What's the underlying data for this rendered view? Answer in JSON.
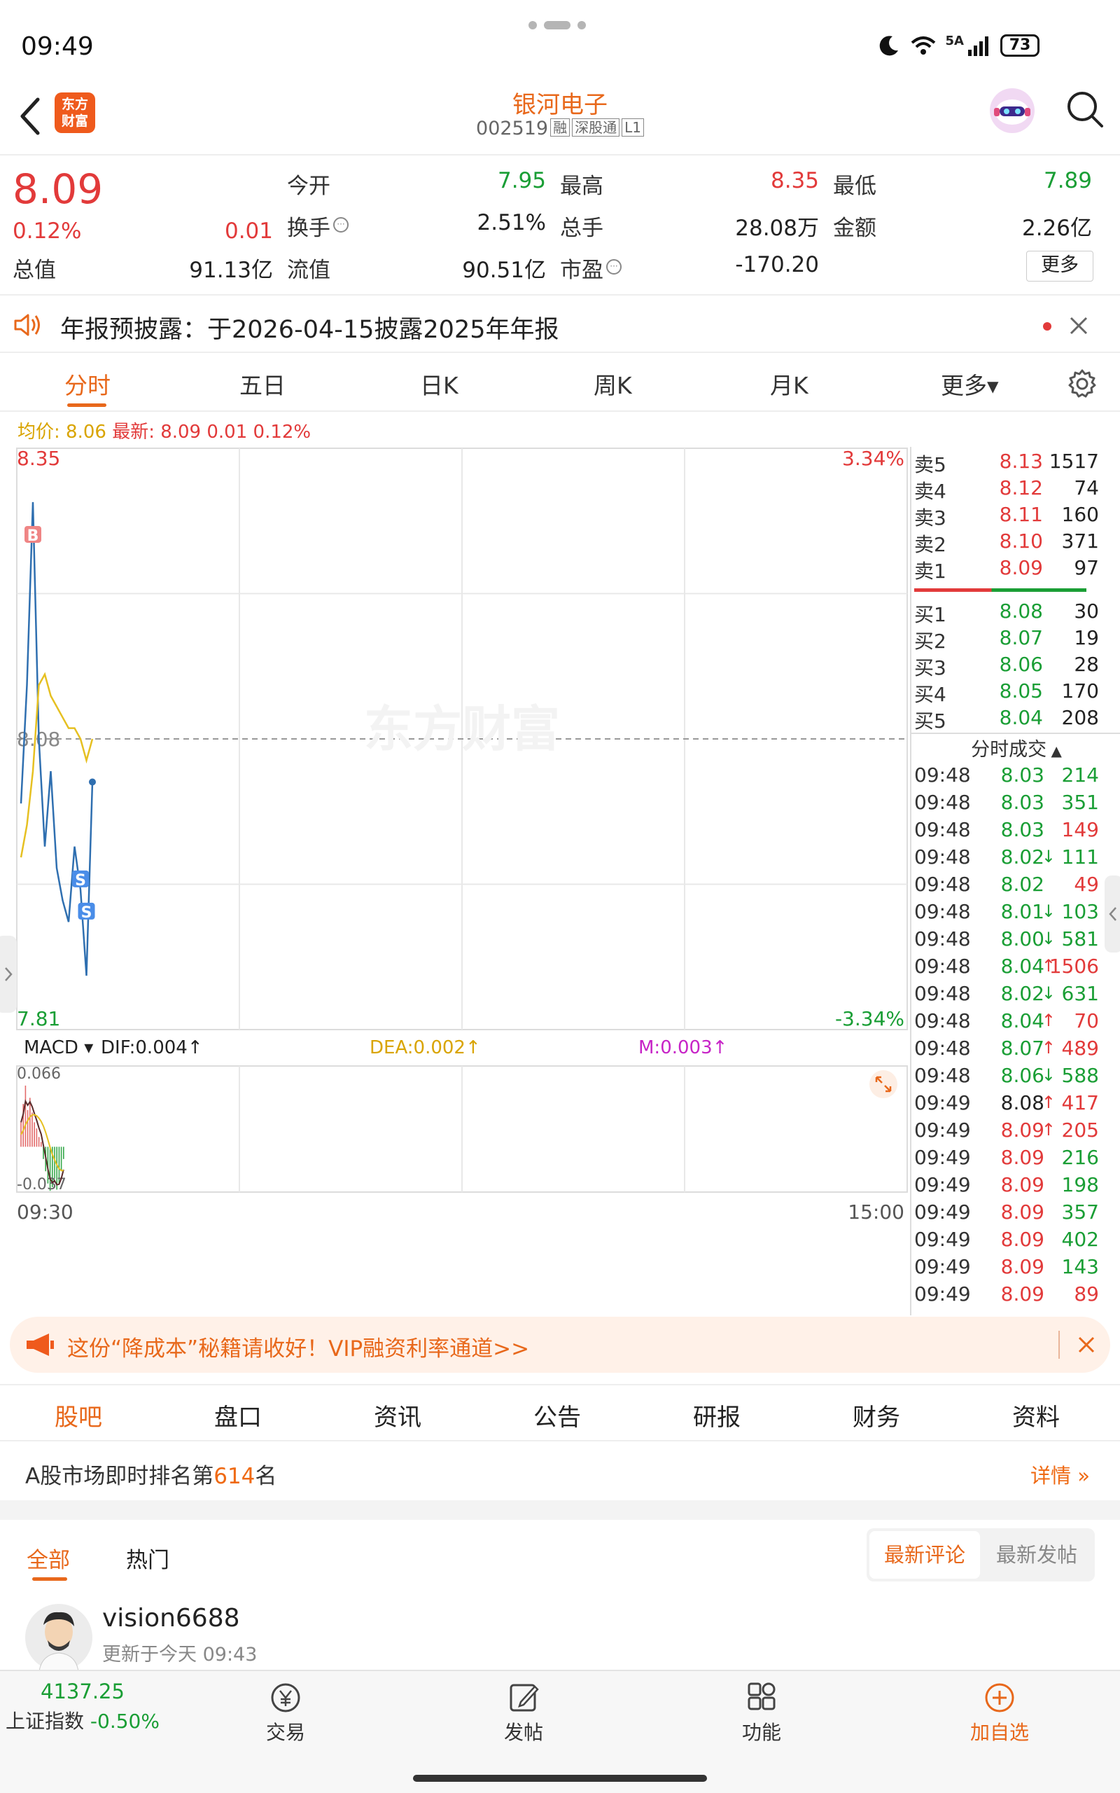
{
  "status_bar": {
    "time": "09:49",
    "network": "5A",
    "battery": "73"
  },
  "header": {
    "app_logo": "东方财富",
    "stock_name": "银河电子",
    "stock_code": "002519",
    "tags": [
      "融",
      "深股通",
      "L1"
    ]
  },
  "quote": {
    "price": "8.09",
    "change_pct": "0.12%",
    "change": "0.01",
    "total_value_label": "总值",
    "total_value": "91.13亿",
    "fields": [
      {
        "label": "今开",
        "value": "7.95",
        "color": "#1a9e35"
      },
      {
        "label": "最高",
        "value": "8.35",
        "color": "#e23a3a"
      },
      {
        "label": "最低",
        "value": "7.89",
        "color": "#1a9e35"
      },
      {
        "label": "换手",
        "value": "2.51%",
        "color": "#222222"
      },
      {
        "label": "总手",
        "value": "28.08万",
        "color": "#222222"
      },
      {
        "label": "金额",
        "value": "2.26亿",
        "color": "#222222"
      },
      {
        "label": "流值",
        "value": "90.51亿",
        "color": "#222222"
      },
      {
        "label": "市盈",
        "value": "-170.20",
        "color": "#222222"
      }
    ],
    "more_button": "更多"
  },
  "notice": {
    "text": "年报预披露：于2026-04-15披露2025年年报"
  },
  "chart_tabs": [
    "分时",
    "五日",
    "日K",
    "周K",
    "月K",
    "更多▾"
  ],
  "chart_legend": {
    "avg_label": "均价: 8.06",
    "latest_label": "最新: 8.09 0.01 0.12%"
  },
  "chart_data": [
    {
      "type": "line",
      "title": "",
      "ylim": [
        7.81,
        8.35
      ],
      "y_max_label": "8.35",
      "y_min_label": "7.81",
      "ref_label": "8.08",
      "pct_max_label": "3.34%",
      "pct_min_label": "-3.34%",
      "x_start_label": "09:30",
      "x_end_label": "15:00",
      "watermark": "东方财富",
      "series": [
        {
          "values": [
            8.02,
            8.13,
            8.3,
            8.08,
            7.98,
            8.05,
            7.96,
            7.93,
            7.91,
            7.98,
            7.94,
            7.86,
            8.04
          ]
        },
        {
          "values": [
            7.97,
            8.0,
            8.05,
            8.13,
            8.14,
            8.12,
            8.11,
            8.1,
            8.09,
            8.09,
            8.08,
            8.06,
            8.08
          ]
        }
      ],
      "markers": [
        {
          "label": "B",
          "value": 8.27
        },
        {
          "label": "S",
          "value": 7.95
        },
        {
          "label": "S",
          "value": 7.92
        }
      ]
    },
    {
      "type": "bar",
      "title": "",
      "indicator": "MACD",
      "dif_label": "DIF:0.004↑",
      "dea_label": "DEA:0.002↑",
      "m_label": "M:0.003↑",
      "ylim": [
        -0.037,
        0.066
      ],
      "y_max_label": "0.066",
      "y_min_label": "-0.037",
      "values": [
        0.02,
        0.035,
        0.05,
        0.03,
        0.04,
        0.028,
        0.02,
        0.015,
        0.008,
        0.004,
        -0.01,
        -0.02,
        -0.03,
        -0.036,
        -0.033,
        -0.026,
        -0.035,
        -0.03,
        -0.02,
        -0.01
      ]
    }
  ],
  "order_book": {
    "asks": [
      {
        "label": "卖5",
        "price": "8.13",
        "vol": "1517"
      },
      {
        "label": "卖4",
        "price": "8.12",
        "vol": "74"
      },
      {
        "label": "卖3",
        "price": "8.11",
        "vol": "160"
      },
      {
        "label": "卖2",
        "price": "8.10",
        "vol": "371"
      },
      {
        "label": "卖1",
        "price": "8.09",
        "vol": "97"
      }
    ],
    "bids": [
      {
        "label": "买1",
        "price": "8.08",
        "vol": "30"
      },
      {
        "label": "买2",
        "price": "8.07",
        "vol": "19"
      },
      {
        "label": "买3",
        "price": "8.06",
        "vol": "28"
      },
      {
        "label": "买4",
        "price": "8.05",
        "vol": "170"
      },
      {
        "label": "买5",
        "price": "8.04",
        "vol": "208"
      }
    ],
    "ticks_title": "分时成交",
    "ticks": [
      {
        "time": "09:48",
        "price": "8.03",
        "arrow": "",
        "vol": "214",
        "pc": "#1a9e35",
        "vc": "#1a9e35"
      },
      {
        "time": "09:48",
        "price": "8.03",
        "arrow": "",
        "vol": "351",
        "pc": "#1a9e35",
        "vc": "#1a9e35"
      },
      {
        "time": "09:48",
        "price": "8.03",
        "arrow": "",
        "vol": "149",
        "pc": "#1a9e35",
        "vc": "#e23a3a"
      },
      {
        "time": "09:48",
        "price": "8.02",
        "arrow": "↓",
        "vol": "111",
        "pc": "#1a9e35",
        "vc": "#1a9e35"
      },
      {
        "time": "09:48",
        "price": "8.02",
        "arrow": "",
        "vol": "49",
        "pc": "#1a9e35",
        "vc": "#e23a3a"
      },
      {
        "time": "09:48",
        "price": "8.01",
        "arrow": "↓",
        "vol": "103",
        "pc": "#1a9e35",
        "vc": "#1a9e35"
      },
      {
        "time": "09:48",
        "price": "8.00",
        "arrow": "↓",
        "vol": "581",
        "pc": "#1a9e35",
        "vc": "#1a9e35"
      },
      {
        "time": "09:48",
        "price": "8.04",
        "arrow": "↑",
        "vol": "1506",
        "pc": "#1a9e35",
        "vc": "#e23a3a"
      },
      {
        "time": "09:48",
        "price": "8.02",
        "arrow": "↓",
        "vol": "631",
        "pc": "#1a9e35",
        "vc": "#1a9e35"
      },
      {
        "time": "09:48",
        "price": "8.04",
        "arrow": "↑",
        "vol": "70",
        "pc": "#1a9e35",
        "vc": "#e23a3a"
      },
      {
        "time": "09:48",
        "price": "8.07",
        "arrow": "↑",
        "vol": "489",
        "pc": "#1a9e35",
        "vc": "#e23a3a"
      },
      {
        "time": "09:48",
        "price": "8.06",
        "arrow": "↓",
        "vol": "588",
        "pc": "#1a9e35",
        "vc": "#1a9e35"
      },
      {
        "time": "09:49",
        "price": "8.08",
        "arrow": "↑",
        "vol": "417",
        "pc": "#222222",
        "vc": "#e23a3a"
      },
      {
        "time": "09:49",
        "price": "8.09",
        "arrow": "↑",
        "vol": "205",
        "pc": "#e23a3a",
        "vc": "#e23a3a"
      },
      {
        "time": "09:49",
        "price": "8.09",
        "arrow": "",
        "vol": "216",
        "pc": "#e23a3a",
        "vc": "#1a9e35"
      },
      {
        "time": "09:49",
        "price": "8.09",
        "arrow": "",
        "vol": "198",
        "pc": "#e23a3a",
        "vc": "#1a9e35"
      },
      {
        "time": "09:49",
        "price": "8.09",
        "arrow": "",
        "vol": "357",
        "pc": "#e23a3a",
        "vc": "#1a9e35"
      },
      {
        "time": "09:49",
        "price": "8.09",
        "arrow": "",
        "vol": "402",
        "pc": "#e23a3a",
        "vc": "#1a9e35"
      },
      {
        "time": "09:49",
        "price": "8.09",
        "arrow": "",
        "vol": "143",
        "pc": "#e23a3a",
        "vc": "#1a9e35"
      },
      {
        "time": "09:49",
        "price": "8.09",
        "arrow": "",
        "vol": "89",
        "pc": "#e23a3a",
        "vc": "#e23a3a"
      }
    ]
  },
  "promo": {
    "text": "这份“降成本”秘籍请收好！VIP融资利率通道>>"
  },
  "section_tabs": [
    "股吧",
    "盘口",
    "资讯",
    "公告",
    "研报",
    "财务",
    "资料"
  ],
  "ranking": {
    "prefix": "A股市场即时排名第",
    "rank": "614",
    "suffix": "名",
    "detail": "详情"
  },
  "feed_filter": {
    "tabs": [
      "全部",
      "热门"
    ],
    "sort_options": [
      "最新评论",
      "最新发帖"
    ]
  },
  "post": {
    "username": "vision6688",
    "updated": "更新于今天 09:43"
  },
  "bottom_nav": {
    "index_value": "4137.25",
    "index_name": "上证指数",
    "index_change": "-0.50%",
    "items": [
      "交易",
      "发帖",
      "功能",
      "加自选"
    ]
  },
  "colors": {
    "up": "#e23a3a",
    "down": "#1a9e35",
    "accent": "#e8681b",
    "price_line": "#2f6fb0",
    "avg_line": "#e6c021"
  }
}
